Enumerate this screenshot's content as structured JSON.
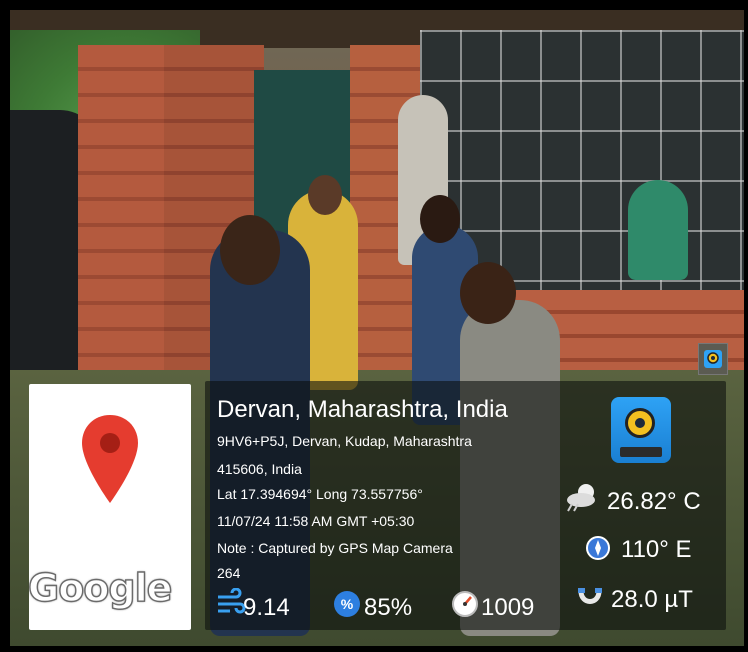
{
  "location": {
    "title": "Dervan, Maharashtra, India",
    "address_line1": "9HV6+P5J, Dervan, Kudap, Maharashtra",
    "address_line2": "415606, India",
    "coords": "Lat 17.394694° Long 73.557756°",
    "datetime": "11/07/24 11:58 AM GMT +05:30",
    "note": "Note : Captured by GPS Map Camera",
    "extra": "264"
  },
  "map": {
    "logo_text": "Google",
    "pin_color": "#e53c2f"
  },
  "stats": {
    "temperature": "26.82° C",
    "compass": "110° E",
    "magnetic": "28.0 µT",
    "wind": "9.14",
    "humidity": "85%",
    "pressure": "1009"
  },
  "icons": {
    "weather": "cloud-icon",
    "compass": "compass-icon",
    "magnet": "magnet-icon",
    "wind": "wind-icon",
    "humidity": "humidity-icon",
    "pressure": "pressure-gauge-icon",
    "app": "gps-map-camera-app-icon"
  },
  "colors": {
    "overlay_bg": "rgba(10,14,12,0.58)",
    "accent_blue": "#2ea2f5",
    "pin_red": "#e53c2f"
  }
}
